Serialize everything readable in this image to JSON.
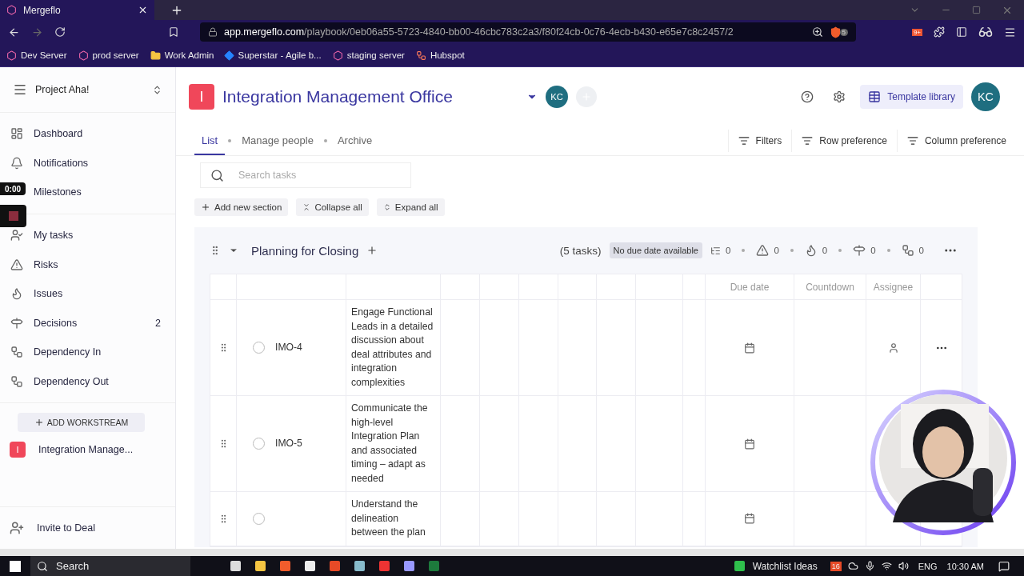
{
  "browser": {
    "tab_title": "Mergeflo",
    "url_host": "app.mergeflo.com",
    "url_path": "/playbook/0eb06a55-5723-4840-bb00-46cbc783c2a3/f80f24cb-0c76-4ecb-b430-e65e7c8c2457/2",
    "shield_count": "5",
    "extension_count": "9+",
    "bookmarks": [
      {
        "kind": "app",
        "label": "Dev Server"
      },
      {
        "kind": "app",
        "label": "prod server"
      },
      {
        "kind": "folder",
        "label": "Work Admin"
      },
      {
        "kind": "diamond",
        "label": "Superstar - Agile b..."
      },
      {
        "kind": "app",
        "label": "staging server"
      },
      {
        "kind": "hub",
        "label": "Hubspot"
      }
    ]
  },
  "recorder": {
    "time": "0:00"
  },
  "sidebar": {
    "project": "Project Aha!",
    "nav_groups": [
      [
        {
          "kind": "dashboard",
          "label": "Dashboard"
        },
        {
          "kind": "bell",
          "label": "Notifications"
        },
        {
          "kind": "milestones",
          "label": "Milestones"
        }
      ],
      [
        {
          "kind": "tasks",
          "label": "My tasks"
        },
        {
          "kind": "risk",
          "label": "Risks"
        },
        {
          "kind": "issue",
          "label": "Issues"
        },
        {
          "kind": "decision",
          "label": "Decisions",
          "badge": "2"
        },
        {
          "kind": "dep",
          "label": "Dependency In"
        },
        {
          "kind": "dep",
          "label": "Dependency Out"
        }
      ]
    ],
    "add_workstream": "ADD WORKSTREAM",
    "workstreams": [
      {
        "initial": "I",
        "label": "Integration Manage...",
        "color": "#f0475a"
      }
    ],
    "invite": "Invite to Deal"
  },
  "header": {
    "initial": "I",
    "title": "Integration Management Office",
    "members": [
      "KC"
    ],
    "template_library": "Template library",
    "user": "KC"
  },
  "tabs": [
    {
      "label": "List",
      "selected": true
    },
    {
      "label": "Manage people",
      "selected": false
    },
    {
      "label": "Archive",
      "selected": false
    }
  ],
  "toolbar": [
    "Filters",
    "Row preference",
    "Column preference"
  ],
  "search": {
    "placeholder": "Search tasks"
  },
  "actions": [
    {
      "kind": "add",
      "label": "Add new section"
    },
    {
      "kind": "collapse",
      "label": "Collapse all"
    },
    {
      "kind": "expand",
      "label": "Expand all"
    }
  ],
  "section": {
    "title": "Planning for Closing",
    "count": "(5 tasks)",
    "due": "No due date available",
    "stats": [
      {
        "kind": "subtasks",
        "count": "0"
      },
      {
        "kind": "risk",
        "count": "0"
      },
      {
        "kind": "issue",
        "count": "0"
      },
      {
        "kind": "decision",
        "count": "0"
      },
      {
        "kind": "dep",
        "count": "0"
      }
    ],
    "columns": [
      "Due date",
      "Countdown",
      "Assignee"
    ],
    "rows": [
      {
        "id": "IMO-4",
        "text": "Engage Functional Leads in a detailed discussion about deal attributes and integration complexities",
        "checked": false,
        "row_actions": [
          {
            "kind": "assignee"
          },
          {
            "kind": "more"
          }
        ]
      },
      {
        "id": "IMO-5",
        "text": "Communicate the high-level Integration Plan and associated timing – adapt as needed",
        "checked": false
      },
      {
        "id": "",
        "text": "Understand the delineation between the plan",
        "checked": false
      }
    ]
  },
  "taskbar": {
    "search": "Search",
    "watchlist": "Watchlist Ideas",
    "tray_badge": "16",
    "language": "ENG",
    "time": "10:30 AM"
  }
}
